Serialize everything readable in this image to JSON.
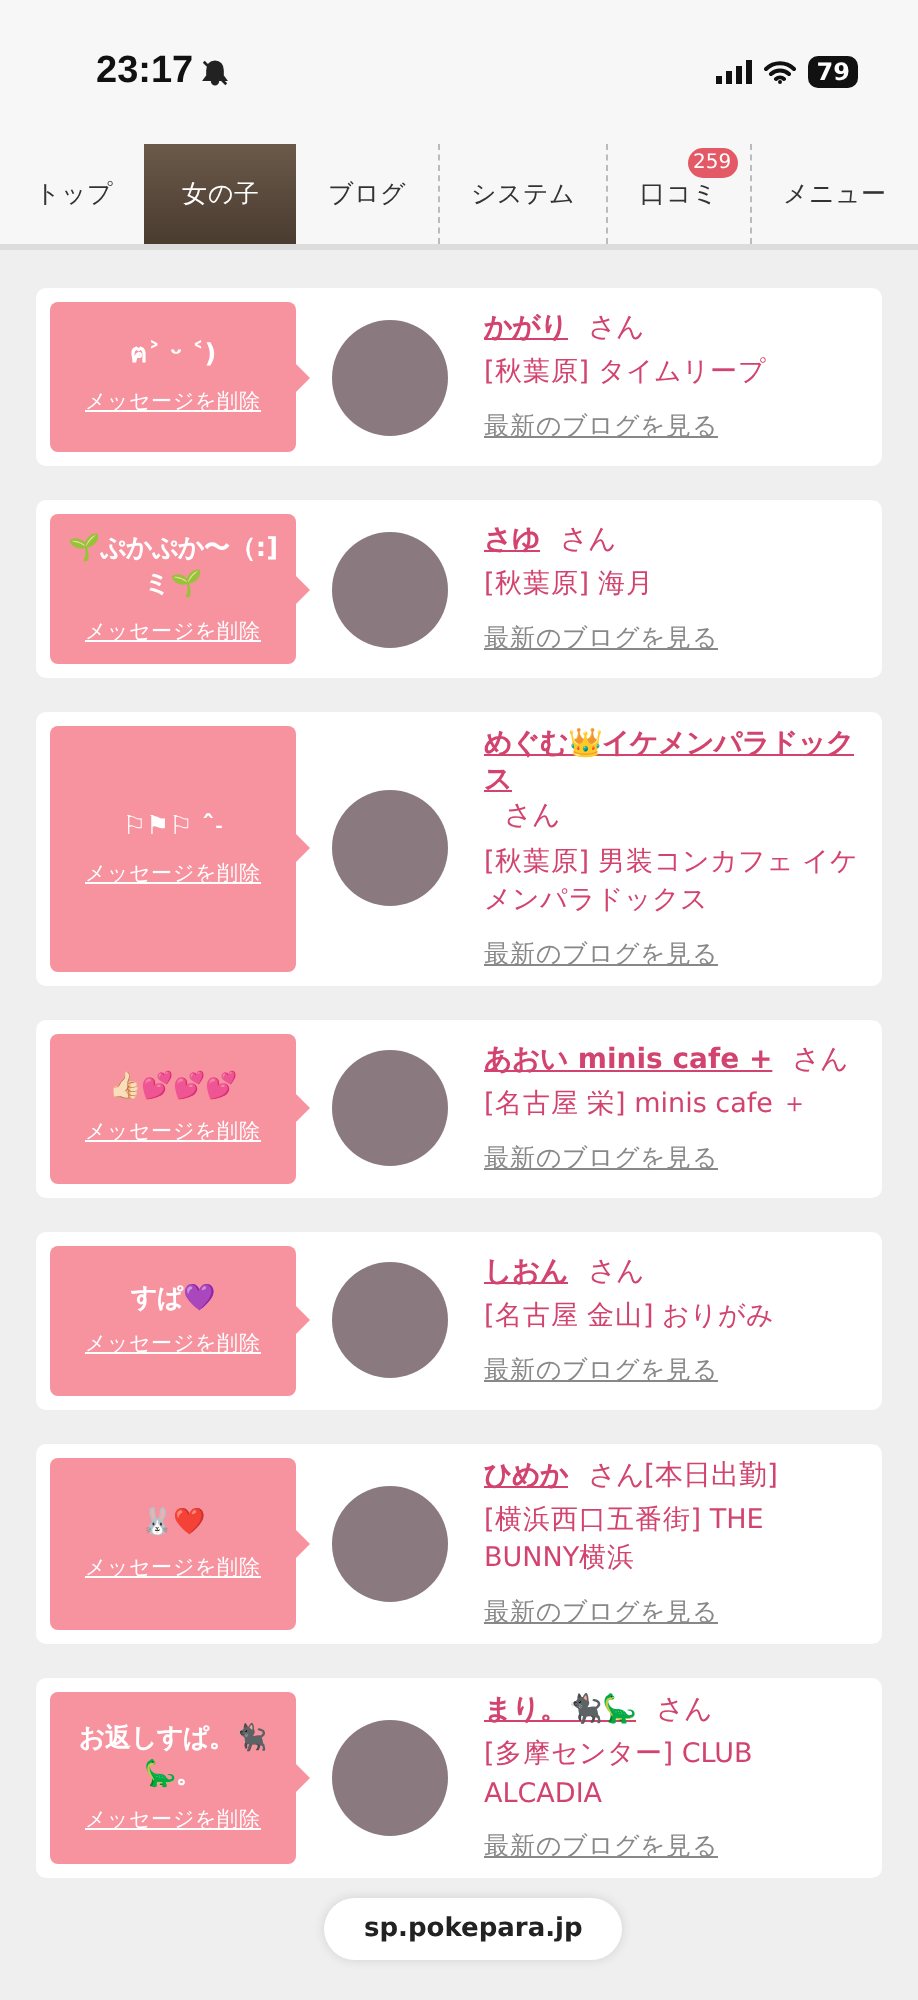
{
  "status_bar": {
    "time": "23:17",
    "battery": "79"
  },
  "tabs": [
    {
      "label": "トップ",
      "selected": false
    },
    {
      "label": "女の子",
      "selected": true
    },
    {
      "label": "ブログ",
      "selected": false
    },
    {
      "label": "システム",
      "selected": false
    },
    {
      "label": "口コミ",
      "selected": false,
      "badge": "259"
    },
    {
      "label": "メニュー",
      "selected": false
    }
  ],
  "messages": [
    {
      "message": "ฅ˃ ᵕ ˂)",
      "delete_link": "メッセージを削除",
      "name": "かがり",
      "honorific": "さん",
      "shop": "[秋葉原] タイムリープ",
      "blog_link": "最新のブログを見る"
    },
    {
      "message": "🌱ぷかぷか〜（:]ミ🌱",
      "delete_link": "メッセージを削除",
      "name": "さゆ",
      "honorific": "さん",
      "shop": "[秋葉原] 海月",
      "blog_link": "最新のブログを見る"
    },
    {
      "message": "⚐⚑⚐ ˆ˗",
      "delete_link": "メッセージを削除",
      "name": "めぐむ👑イケメンパラドックス",
      "honorific": "さん",
      "shop": "[秋葉原] 男装コンカフェ イケメンパラドックス",
      "blog_link": "最新のブログを見る"
    },
    {
      "message": "👍🏻💕💕💕",
      "delete_link": "メッセージを削除",
      "name": "あおい minis cafe +",
      "honorific": "さん",
      "shop": "[名古屋 栄] minis cafe ＋",
      "blog_link": "最新のブログを見る"
    },
    {
      "message": "すぱ💜",
      "delete_link": "メッセージを削除",
      "name": "しおん",
      "honorific": "さん",
      "shop": "[名古屋 金山] おりがみ",
      "blog_link": "最新のブログを見る"
    },
    {
      "message": "🐰❤️",
      "delete_link": "メッセージを削除",
      "name": "ひめか",
      "honorific": "さん[本日出勤]",
      "shop": "[横浜西口五番街] THE BUNNY横浜",
      "blog_link": "最新のブログを見る"
    },
    {
      "message": "お返しすぱ。🐈‍⬛🦕。",
      "delete_link": "メッセージを削除",
      "name": "まり。🐈‍⬛🦕",
      "honorific": "さん",
      "shop": "[多摩センター] CLUB ALCADIA",
      "blog_link": "最新のブログを見る"
    }
  ],
  "url_pill": "sp.pokepara.jp"
}
